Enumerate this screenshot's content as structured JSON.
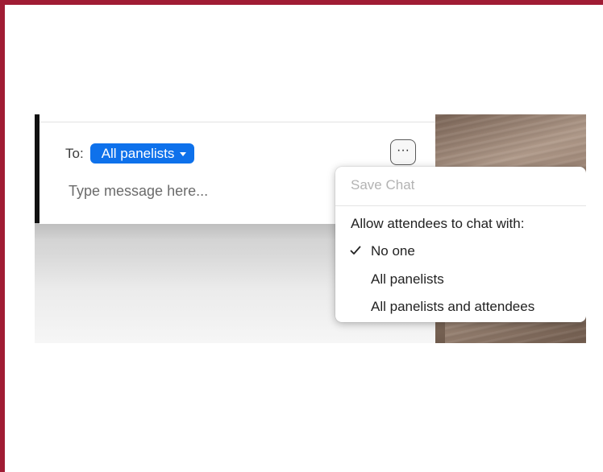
{
  "frame": {
    "accent_color": "#a01c34"
  },
  "chat_panel": {
    "to_label": "To:",
    "recipient": "All panelists",
    "recipient_color": "#0e71eb",
    "caret_icon": "triangle-down-icon",
    "message_placeholder": "Type message here...",
    "message_value": "",
    "more_icon": "ellipsis-icon",
    "more_label": "···"
  },
  "menu": {
    "save_chat": "Save Chat",
    "section_heading": "Allow attendees to chat with:",
    "options": [
      {
        "label": "No one",
        "checked": true
      },
      {
        "label": "All panelists",
        "checked": false
      },
      {
        "label": "All panelists and attendees",
        "checked": false
      }
    ],
    "check_icon": "checkmark-icon"
  }
}
